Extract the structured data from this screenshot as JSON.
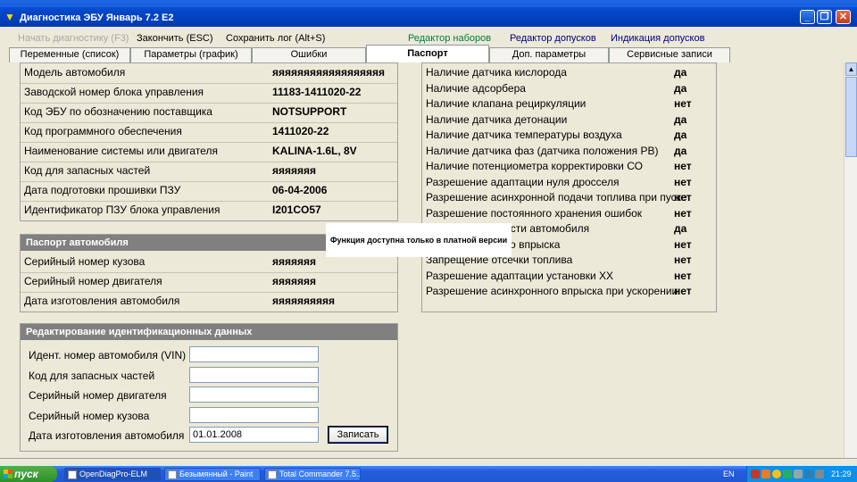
{
  "window": {
    "title": "Диагностика ЭБУ Январь 7.2 E2",
    "minimize": "_",
    "restore": "❐",
    "close": "✕"
  },
  "toolbar": {
    "start_diag": "Начать диагностику (F3)",
    "finish": "Закончить (ESC)",
    "save_log": "Сохранить лог (Alt+S)",
    "set_editor": "Редактор наборов",
    "tol_editor": "Редактор допусков",
    "tol_indication": "Индикация допусков"
  },
  "tabs": [
    "Переменные (список)",
    "Параметры (график)",
    "Ошибки",
    "Паспорт",
    "Доп. параметры",
    "Сервисные записи"
  ],
  "ecu_info": [
    {
      "label": "Модель автомобиля",
      "value": "яяяяяяяяяяяяяяяяяя"
    },
    {
      "label": "Заводской номер блока управления",
      "value": "11183-1411020-22"
    },
    {
      "label": "Код ЭБУ по обозначению поставщика",
      "value": "NOTSUPPORT"
    },
    {
      "label": "Код программного обеспечения",
      "value": "1411020-22"
    },
    {
      "label": "Наименование системы или двигателя",
      "value": "KALINA-1.6L, 8V"
    },
    {
      "label": "Код для запасных частей",
      "value": "яяяяяяя"
    },
    {
      "label": "Дата подготовки прошивки ПЗУ",
      "value": "06-04-2006"
    },
    {
      "label": "Идентификатор ПЗУ блока управления",
      "value": "I201CO57"
    }
  ],
  "car_passport": {
    "header": "Паспорт автомобиля",
    "rows": [
      {
        "label": "Серийный номер кузова",
        "value": "яяяяяяя"
      },
      {
        "label": "Серийный номер двигателя",
        "value": "яяяяяяя"
      },
      {
        "label": "Дата изготовления автомобиля",
        "value": "яяяяяяяяяя"
      }
    ]
  },
  "edit_ident": {
    "header": "Редактирование идентификационных данных",
    "fields": [
      {
        "label": "Идент. номер автомобиля (VIN)",
        "value": ""
      },
      {
        "label": "Код для запасных частей",
        "value": ""
      },
      {
        "label": "Серийный номер двигателя",
        "value": ""
      },
      {
        "label": "Серийный номер кузова",
        "value": ""
      },
      {
        "label": "Дата изготовления автомобиля",
        "value": "01.01.2008"
      }
    ],
    "write_button": "Записать"
  },
  "features": [
    {
      "label": "Наличие датчика кислорода",
      "value": "да"
    },
    {
      "label": "Наличие адсорбера",
      "value": "да"
    },
    {
      "label": "Наличие клапана рециркуляции",
      "value": "нет"
    },
    {
      "label": "Наличие датчика детонации",
      "value": "да"
    },
    {
      "label": "Наличие датчика температуры воздуха",
      "value": "да"
    },
    {
      "label": "Наличие датчика фаз (датчика положения РВ)",
      "value": "да"
    },
    {
      "label": "Наличие потенциометра корректировки СО",
      "value": "нет"
    },
    {
      "label": "Разрешение адаптации нуля дросселя",
      "value": "нет"
    },
    {
      "label": "Разрешение асинхронной подачи топлива при пуске",
      "value": "нет"
    },
    {
      "label": "Разрешение постоянного хранения ошибок",
      "value": "нет"
    },
    {
      "label": "                   скорости автомобиля",
      "value": "да"
    },
    {
      "label": "                   енного впрыска",
      "value": "нет"
    },
    {
      "label": "Запрещение отсечки топлива",
      "value": "нет"
    },
    {
      "label": "Разрешение адаптации установки ХХ",
      "value": "нет"
    },
    {
      "label": "Разрешение асинхронного впрыска при ускорении",
      "value": "нет"
    }
  ],
  "popup": {
    "text": "Функция доступна только в платной версии"
  },
  "taskbar": {
    "start": "пуск",
    "items": [
      "OpenDiagPro-ELM",
      "Безымянный - Paint",
      "Total Commander 7.5..."
    ],
    "lang": "EN",
    "clock": "21:29"
  },
  "colors": {
    "titlebar": "#0446c8",
    "link": "#00007f",
    "link_green": "#007f3f",
    "header_bg": "#808080",
    "window_bg": "#ece9d8"
  }
}
